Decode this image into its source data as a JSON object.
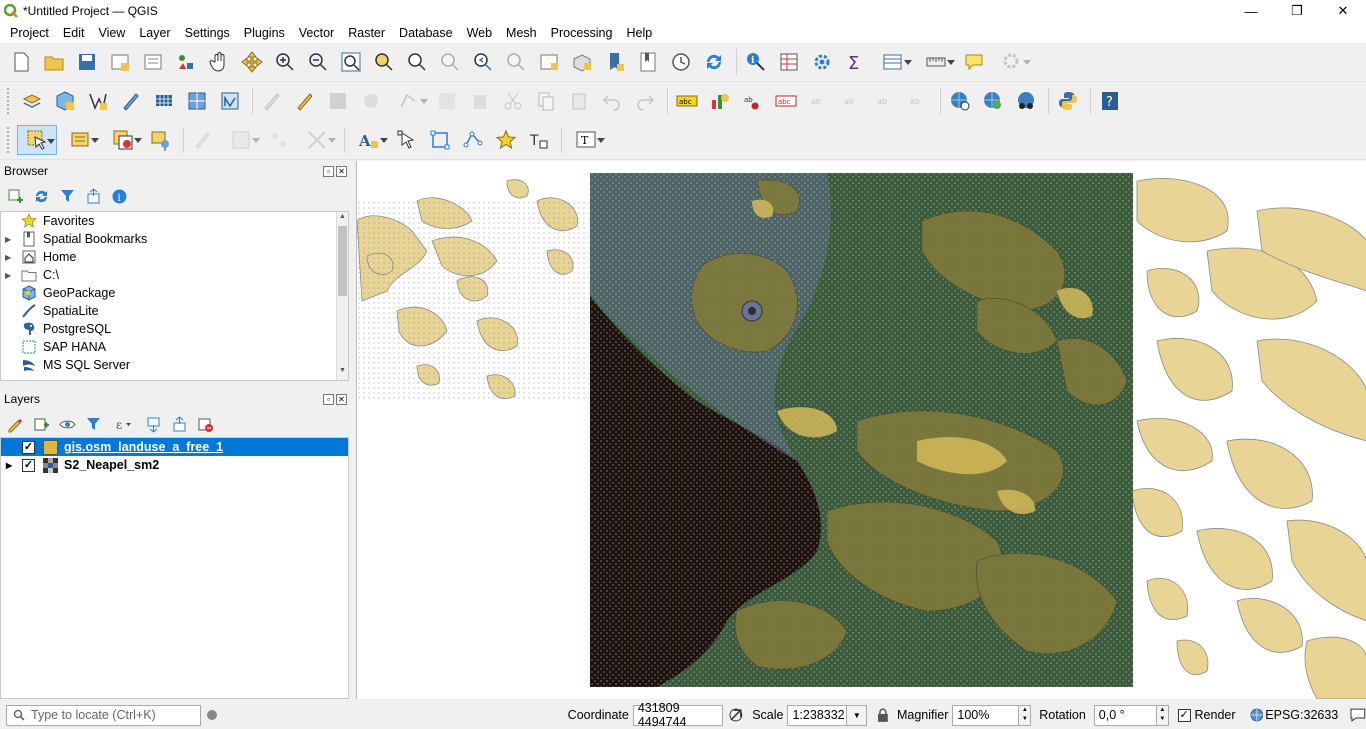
{
  "window": {
    "title": "*Untitled Project — QGIS",
    "controls": [
      "—",
      "❐",
      "✕"
    ]
  },
  "menubar": [
    "Project",
    "Edit",
    "View",
    "Layer",
    "Settings",
    "Plugins",
    "Vector",
    "Raster",
    "Database",
    "Web",
    "Mesh",
    "Processing",
    "Help"
  ],
  "toolbars": {
    "row1": [
      "new-project-icon",
      "open-project-icon",
      "save-project-icon",
      "new-print-layout-icon",
      "layout-manager-icon",
      "style-manager-icon",
      "pan-icon",
      "pan-to-selection-icon",
      "zoom-in-icon",
      "zoom-out-icon",
      "zoom-full-icon",
      "zoom-to-selection-icon",
      "zoom-to-layer-icon",
      "zoom-native-icon",
      "zoom-last-icon",
      "zoom-next-icon",
      "new-map-view-icon",
      "new-3d-view-icon",
      "new-bookmark-icon",
      "show-bookmarks-icon",
      "temporal-controller-icon",
      "refresh-icon",
      "identify-icon",
      "attribute-table-icon",
      "processing-toolbox-icon",
      "statistics-icon",
      "open-attribute-table-icon",
      "measure-icon",
      "map-tips-icon",
      "locator-gear-icon"
    ],
    "row2": [
      "data-source-manager-icon",
      "new-geopackage-layer-icon",
      "new-temporary-layer-icon",
      "digitize-icon",
      "new-mesh-layer-icon",
      "new-virtual-layer-icon",
      "open-layer-icon",
      "current-edits-icon",
      "toggle-editing-icon",
      "save-edits-icon",
      "add-feature-icon",
      "vertex-tool-icon",
      "modify-attributes-icon",
      "delete-selected-icon",
      "cut-features-icon",
      "copy-features-icon",
      "paste-features-icon",
      "undo-icon",
      "redo-icon",
      "label-toolbar-icon",
      "diagram-icon",
      "pin-labels-icon",
      "highlight-pinned-icon",
      "show-hide-labels-icon",
      "move-label-icon",
      "rotate-label-icon",
      "change-label-icon",
      "metasearch-icon",
      "wms-icon",
      "openlayers-icon",
      "python-console-icon",
      "help-icon"
    ],
    "row3": [
      "select-features-icon",
      "select-by-value-icon",
      "deselect-icon",
      "select-by-location-icon",
      "advanced-digitizing-icon",
      "shape-digitizing-icon",
      "snapping-icon",
      "annotation-icon",
      "label-annotation-icon",
      "node-tool-icon",
      "split-parts-icon",
      "add-part-icon",
      "favorite-icon",
      "text-annotation-icon",
      "text-format-icon"
    ]
  },
  "browser": {
    "title": "Browser",
    "items": [
      {
        "label": "Favorites",
        "expandable": false,
        "icon": "star-icon"
      },
      {
        "label": "Spatial Bookmarks",
        "expandable": true,
        "icon": "bookmarks-icon"
      },
      {
        "label": "Home",
        "expandable": true,
        "icon": "home-icon"
      },
      {
        "label": "C:\\",
        "expandable": true,
        "icon": "folder-icon"
      },
      {
        "label": "GeoPackage",
        "expandable": false,
        "icon": "geopackage-icon"
      },
      {
        "label": "SpatiaLite",
        "expandable": false,
        "icon": "spatialite-icon"
      },
      {
        "label": "PostgreSQL",
        "expandable": false,
        "icon": "postgresql-icon"
      },
      {
        "label": "SAP HANA",
        "expandable": false,
        "icon": "saphana-icon"
      },
      {
        "label": "MS SQL Server",
        "expandable": false,
        "icon": "mssql-icon"
      }
    ]
  },
  "layers": {
    "title": "Layers",
    "items": [
      {
        "label": "gis.osm_landuse_a_free_1",
        "checked": "✓",
        "selected": true,
        "color": "#dbb743"
      },
      {
        "label": "S2_Neapel_sm2",
        "checked": "✓",
        "selected": false,
        "expandable": true
      }
    ]
  },
  "statusbar": {
    "locate_placeholder": "Type to locate (Ctrl+K)",
    "coordinate_label": "Coordinate",
    "coordinate_value": "431809 4494744",
    "scale_label": "Scale",
    "scale_value": "1:238332",
    "magnifier_label": "Magnifier",
    "magnifier_value": "100%",
    "rotation_label": "Rotation",
    "rotation_value": "0,0 °",
    "render_label": "Render",
    "render_checked": "✓",
    "crs": "EPSG:32633"
  },
  "colors": {
    "landuse_fill": "#e8d595",
    "landuse_outline": "#8a8a8a",
    "raster_sea": "#1e120e",
    "selection": "#0078d7"
  }
}
